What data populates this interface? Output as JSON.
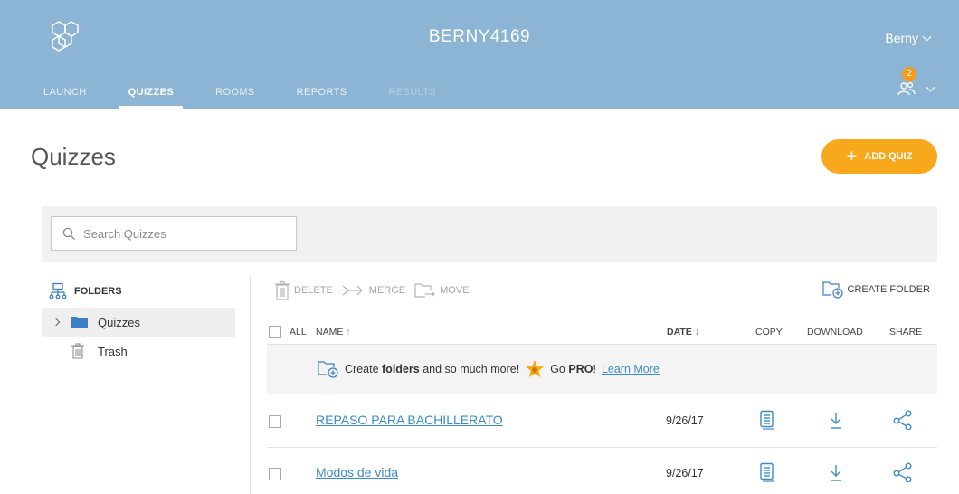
{
  "header": {
    "room_name": "BERNY4169",
    "user_name": "Berny",
    "notifications_count": "2",
    "nav_tabs": [
      "LAUNCH",
      "QUIZZES",
      "ROOMS",
      "REPORTS",
      "RESULTS"
    ],
    "active_tab": "QUIZZES",
    "logo_icon": "hexagon-logo-icon",
    "notification_icon": "users-icon",
    "bg_color": "#8cb4d4"
  },
  "page": {
    "title": "Quizzes",
    "add_quiz_label": "ADD QUIZ",
    "accent_color": "#f7a81b"
  },
  "search": {
    "placeholder": "Search Quizzes"
  },
  "sidebar": {
    "heading": "FOLDERS",
    "items": [
      {
        "label": "Quizzes",
        "icon": "folder-icon",
        "selected": true
      },
      {
        "label": "Trash",
        "icon": "trash-icon",
        "selected": false
      }
    ]
  },
  "toolbar": {
    "delete_label": "DELETE",
    "merge_label": "MERGE",
    "move_label": "MOVE",
    "create_folder_label": "CREATE FOLDER"
  },
  "list": {
    "columns": {
      "all": "ALL",
      "name": "NAME",
      "date": "DATE",
      "copy": "COPY",
      "download": "DOWNLOAD",
      "share": "SHARE"
    },
    "sort": {
      "name": "ascending-arrow",
      "date": "descending-arrow"
    },
    "promo": {
      "text_before": "Create",
      "bold_word": "folders",
      "text_after": "and so much more!",
      "go": "Go",
      "pro": "PRO",
      "exclamation": "!",
      "learn_more": "Learn More"
    },
    "rows": [
      {
        "name": "REPASO PARA BACHILLERATO",
        "date": "9/26/17"
      },
      {
        "name": "Modos de vida",
        "date": "9/26/17"
      }
    ]
  }
}
